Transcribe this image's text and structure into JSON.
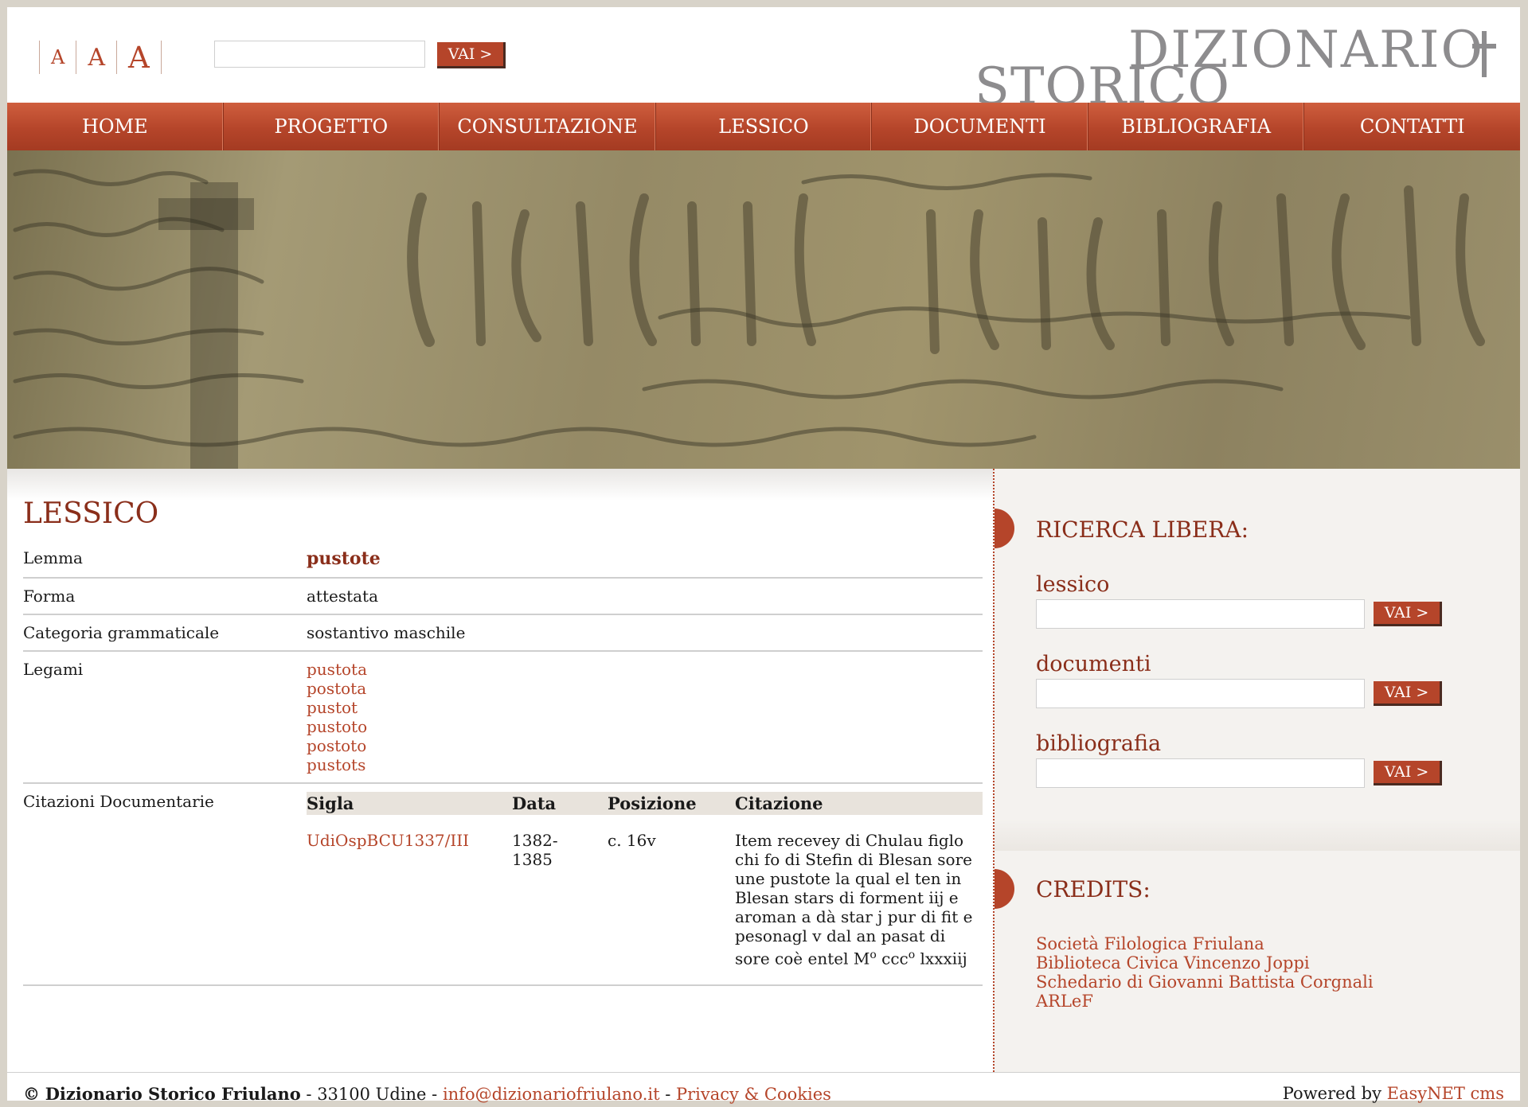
{
  "header": {
    "font_sizes": [
      "A",
      "A",
      "A"
    ],
    "search_value": "",
    "search_button": "VAI >",
    "logo_line1": "DIZIONARIO",
    "logo_line2": "STORICO FRIULANO"
  },
  "nav": [
    "HOME",
    "PROGETTO",
    "CONSULTAZIONE",
    "LESSICO",
    "DOCUMENTI",
    "BIBLIOGRAFIA",
    "CONTATTI"
  ],
  "main": {
    "title": "LESSICO",
    "lemma_label": "Lemma",
    "lemma_value": "pustote",
    "forma_label": "Forma",
    "forma_value": "attestata",
    "categoria_label": "Categoria grammaticale",
    "categoria_value": "sostantivo maschile",
    "legami_label": "Legami",
    "legami": [
      "pustota",
      "postota",
      "pustot",
      "pustoto",
      "postoto",
      "pustots"
    ],
    "citazioni_label": "Citazioni Documentarie",
    "table": {
      "headers": [
        "Sigla",
        "Data",
        "Posizione",
        "Citazione"
      ],
      "rows": [
        {
          "sigla": "UdiOspBCU1337/III",
          "data_1": "1382-",
          "data_2": "1385",
          "posizione": "c. 16v",
          "citazione_text": "Item recevey di Chulau figlo chi fo di Stefin di Blesan sore une pustote la qual el ten in Blesan stars di forment iij e aroman a dà star j pur di fit e pesonagl v dal an pasat di sore coè entel M",
          "sup1": "o",
          "mid": " ccc",
          "sup2": "o",
          "end": " lxxxiij"
        }
      ]
    }
  },
  "sidebar": {
    "search_title": "RICERCA LIBERA:",
    "lessico_label": "lessico",
    "documenti_label": "documenti",
    "bibliografia_label": "bibliografia",
    "vai_label": "VAI >",
    "credits_title": "CREDITS:",
    "credits": [
      "Società Filologica Friulana",
      "Biblioteca Civica Vincenzo Joppi",
      "Schedario di Giovanni Battista Corgnali",
      "ARLeF"
    ]
  },
  "footer": {
    "copyright_mark": "©",
    "site_name": "Dizionario Storico Friulano",
    "address": " - 33100 Udine - ",
    "email": "info@dizionariofriulano.it",
    "dash": " - ",
    "privacy": "Privacy & Cookies",
    "powered_prefix": "Powered by ",
    "powered_link": "EasyNET cms"
  },
  "colors": {
    "accent": "#b5452a",
    "title": "#8a2e1a",
    "logo": "#8d8c8e",
    "sidebar_bg": "#f4f2ef"
  },
  "icons": {
    "logo_cross": "cross-icon",
    "section_marker": "half-circle-marker"
  }
}
